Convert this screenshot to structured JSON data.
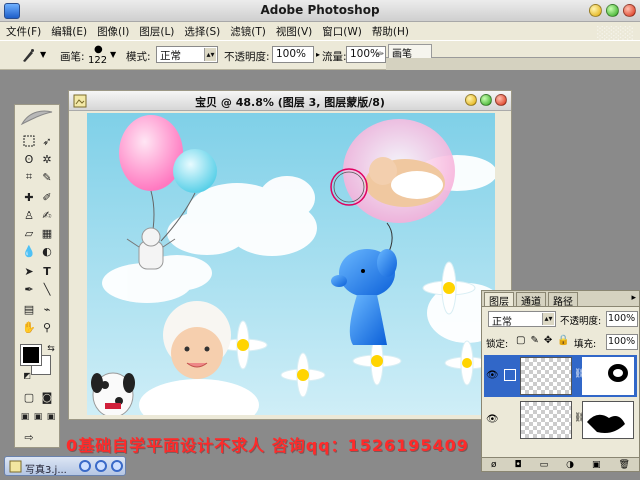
{
  "app": {
    "title": "Adobe Photoshop"
  },
  "menubar": {
    "items": [
      "文件(F)",
      "编辑(E)",
      "图像(I)",
      "图层(L)",
      "选择(S)",
      "滤镜(T)",
      "视图(V)",
      "窗口(W)",
      "帮助(H)"
    ]
  },
  "options": {
    "brush_label": "画笔:",
    "brush_size": "122",
    "mode_label": "模式:",
    "mode_value": "正常",
    "opacity_label": "不透明度:",
    "opacity_value": "100%",
    "flow_label": "流量:",
    "flow_value": "100%"
  },
  "palette_well": {
    "tab_label": "画笔"
  },
  "document": {
    "title": "宝贝 @ 48.8% (图层 3, 图层蒙版/8)"
  },
  "layers_panel": {
    "tabs": [
      "图层",
      "通道",
      "路径"
    ],
    "blend_mode": "正常",
    "opacity_label": "不透明度:",
    "opacity_value": "100%",
    "lock_label": "锁定:",
    "fill_label": "填充:",
    "fill_value": "100%"
  },
  "overlay": {
    "promo_text": "0基础自学平面设计不求人 咨询qq：1526195409"
  },
  "taskbar": {
    "item_label": "写真3.j..."
  },
  "colors": {
    "foreground": "#000000",
    "background": "#ffffff",
    "selected_layer": "#3167c8",
    "promo": "#ff2a2a"
  },
  "icons": [
    "photoshop-logo-icon",
    "brush-tool-icon",
    "marquee-tool-icon",
    "move-tool-icon",
    "lasso-tool-icon",
    "magic-wand-icon",
    "crop-icon",
    "slice-icon",
    "healing-brush-icon",
    "brush-icon",
    "stamp-icon",
    "history-brush-icon",
    "eraser-icon",
    "gradient-icon",
    "blur-icon",
    "dodge-icon",
    "path-select-icon",
    "type-tool-icon",
    "pen-tool-icon",
    "line-tool-icon",
    "notes-icon",
    "eyedropper-icon",
    "hand-icon",
    "zoom-icon",
    "eye-icon",
    "chain-link-icon",
    "trash-icon"
  ]
}
